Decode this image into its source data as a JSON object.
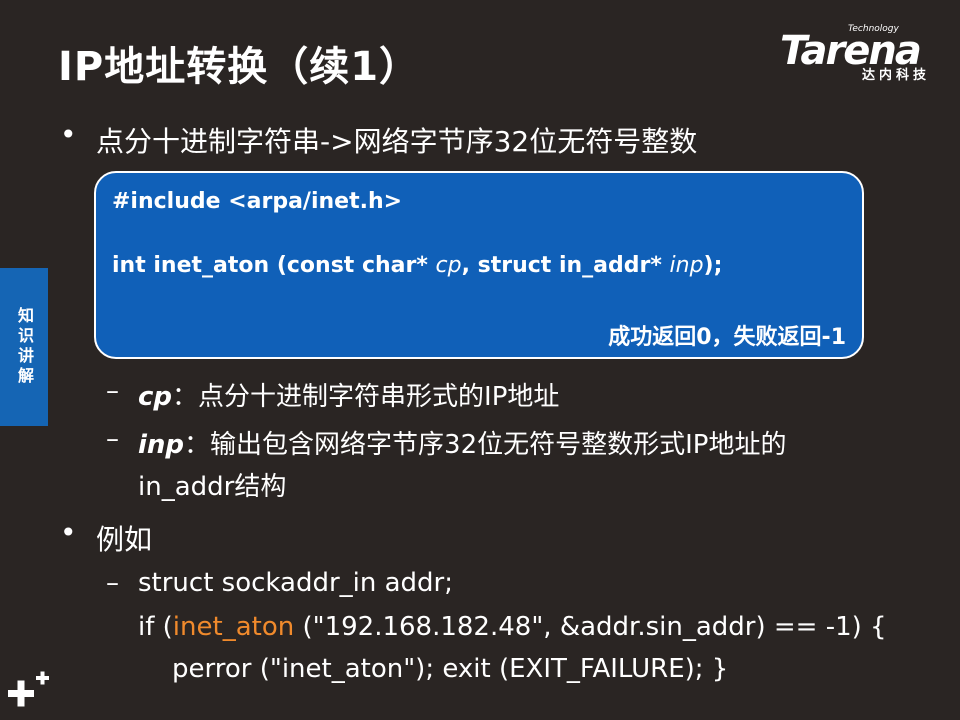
{
  "title": "IP地址转换（续1）",
  "logo": {
    "tagline": "Technology",
    "wordmark": "Tarena",
    "chinese": "达内科技"
  },
  "side_tab": "知识讲解",
  "bullets": [
    "点分十进制字符串->网络字节序32位无符号整数",
    "例如"
  ],
  "codebox": {
    "include": "#include <arpa/inet.h>",
    "proto_a": "int inet_aton (const char* ",
    "proto_cp": "cp",
    "proto_b": ", struct in_addr* ",
    "proto_inp": "inp",
    "proto_c": ");",
    "return_note": "成功返回0，失败返回-1"
  },
  "params": {
    "cp_name": "cp",
    "cp_desc": "：点分十进制字符串形式的IP地址",
    "inp_name": "inp",
    "inp_desc": "：输出包含网络字节序32位无符号整数形式IP地址的",
    "inp_desc2": "in_addr结构"
  },
  "example": {
    "line1": "struct sockaddr_in addr;",
    "line2_a": "if (",
    "line2_fn": "inet_aton",
    "line2_b": " (\"192.168.182.48\", &addr.sin_addr) == -1) {",
    "line3": "perror (\"inet_aton\"); exit (EXIT_FAILURE); }"
  },
  "colors": {
    "background": "#2a2523",
    "box": "#1060b8",
    "side_tab": "#1565b4",
    "highlight": "#f08a2c"
  }
}
